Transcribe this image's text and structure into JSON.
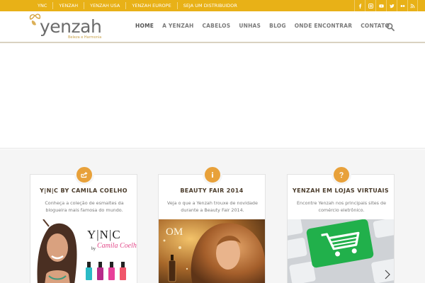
{
  "topbar": {
    "links": [
      "YNC",
      "YENZAH",
      "YENZAH USA",
      "YENZAH EUROPE",
      "SEJA UM DISTRIBUIDOR"
    ],
    "social_icons": [
      "facebook-icon",
      "instagram-icon",
      "youtube-icon",
      "twitter-icon",
      "flickr-icon",
      "rss-icon"
    ],
    "bg_color": "#e8b117"
  },
  "header": {
    "logo_text": "yenzah",
    "logo_tagline": "Beleza e Harmonia",
    "nav": [
      "HOME",
      "A YENZAH",
      "CABELOS",
      "UNHAS",
      "BLOG",
      "ONDE ENCONTRAR",
      "CONTATO"
    ],
    "active_nav": "HOME",
    "search_icon": "search-icon"
  },
  "features": [
    {
      "icon": "share-icon",
      "title": "Y|N|C BY CAMILA COELHO",
      "description": "Conheça a coleção de esmaltes da blogueira mais famosa do mundo.",
      "image_text": {
        "brand": "Y|N|C",
        "by": "by",
        "name": "Camila Coelho"
      }
    },
    {
      "icon": "info-icon",
      "title": "BEAUTY FAIR 2014",
      "description": "Veja o que a Yenzah trouxe de novidade durante a Beauty Fair 2014.",
      "image_text": {
        "brand": "OM"
      }
    },
    {
      "icon": "question-icon",
      "title": "YENZAH EM LOJAS VIRTUAIS",
      "description": "Encontre Yenzah nos principais sites de comércio eletrônico.",
      "image_text": {}
    }
  ],
  "colors": {
    "accent": "#e8a13a",
    "title_text": "#4a3b2a",
    "nav_text": "#7a7a7a"
  }
}
